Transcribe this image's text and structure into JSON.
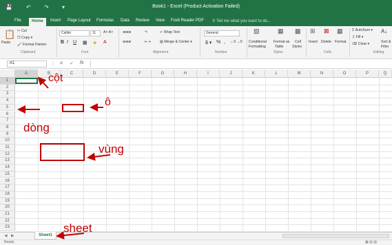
{
  "window": {
    "title": "Book1 - Excel (Product Activation Failed)"
  },
  "tabs": [
    "File",
    "Home",
    "Insert",
    "Page Layout",
    "Formulas",
    "Data",
    "Review",
    "View",
    "Foxit Reader PDF"
  ],
  "tell_me": "Tell me what you want to do...",
  "ribbon": {
    "clipboard": {
      "paste": "Paste",
      "cut": "Cut",
      "copy": "Copy",
      "format_painter": "Format Painter",
      "group": "Clipboard"
    },
    "font": {
      "name": "Calibri",
      "size": "11",
      "group": "Font"
    },
    "alignment": {
      "wrap_text": "Wrap Text",
      "merge": "Merge & Center",
      "group": "Alignment"
    },
    "number": {
      "format": "General",
      "currency": "$",
      "percent": "%",
      "comma": ",",
      "group": "Number"
    },
    "styles": {
      "conditional": "Conditional",
      "conditional2": "Formatting",
      "format_as": "Format as",
      "format_as2": "Table",
      "cell": "Cell",
      "cell2": "Styles",
      "group": "Styles"
    },
    "cells": {
      "insert": "Insert",
      "delete": "Delete",
      "format": "Format",
      "group": "Cells"
    },
    "editing": {
      "autosum": "AutoSum",
      "fill": "Fill",
      "clear": "Clear",
      "sort": "Sort &",
      "filter": "Filter",
      "group": "Editing"
    }
  },
  "formula_bar": {
    "name_box": "A1",
    "fx": "fx"
  },
  "columns": [
    "A",
    "B",
    "C",
    "D",
    "E",
    "F",
    "G",
    "H",
    "I",
    "J",
    "K",
    "L",
    "M",
    "N",
    "O",
    "P",
    "Q"
  ],
  "rows": [
    "1",
    "2",
    "3",
    "4",
    "5",
    "6",
    "7",
    "8",
    "9",
    "10",
    "11",
    "12",
    "13",
    "14",
    "15",
    "16",
    "17",
    "18",
    "19",
    "20",
    "21",
    "22",
    "23"
  ],
  "sheet_tab": "Sheet1",
  "status": "Ready",
  "annotations": {
    "column": "cột",
    "cell": "ô",
    "row": "dòng",
    "range": "vùng",
    "sheet": "sheet"
  },
  "colors": {
    "excel_green": "#217346",
    "annotation_red": "#c00000"
  }
}
